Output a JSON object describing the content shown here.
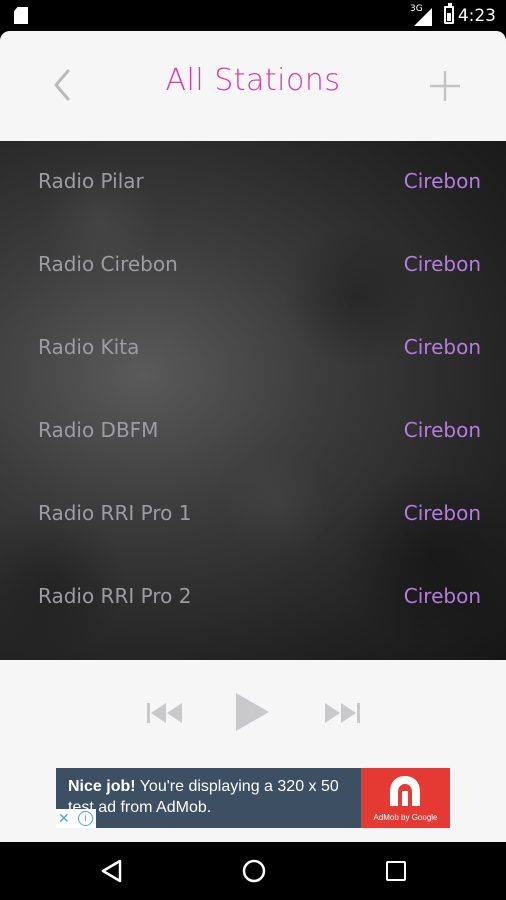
{
  "statusbar": {
    "network": "3G",
    "time": "4:23"
  },
  "header": {
    "title": "All Stations"
  },
  "stations": [
    {
      "name": "Radio Pilar",
      "city": "Cirebon"
    },
    {
      "name": "Radio Cirebon",
      "city": "Cirebon"
    },
    {
      "name": "Radio Kita",
      "city": "Cirebon"
    },
    {
      "name": "Radio DBFM",
      "city": "Cirebon"
    },
    {
      "name": "Radio RRI Pro 1",
      "city": "Cirebon"
    },
    {
      "name": "Radio RRI Pro 2",
      "city": "Cirebon"
    }
  ],
  "ad": {
    "headline": "Nice job!",
    "body": " You're displaying a 320 x 50 test ad from AdMob.",
    "brand": "AdMob by Google"
  },
  "colors": {
    "accent": "#e8359f",
    "city": "#b57ce0",
    "station": "#9e9ca0",
    "ad_red": "#e53a34"
  },
  "icons": {
    "back": "chevron-left-icon",
    "add": "plus-icon",
    "prev": "skip-previous-icon",
    "play": "play-icon",
    "next": "skip-next-icon"
  }
}
